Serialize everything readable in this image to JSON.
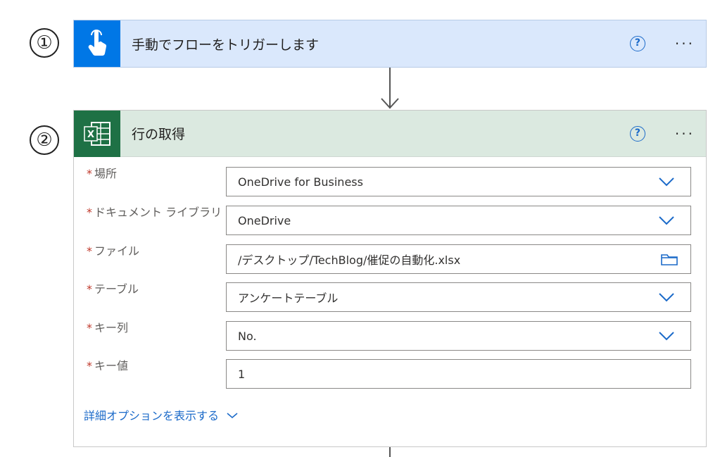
{
  "steps": [
    {
      "number": "①",
      "title": "手動でフローをトリガーします",
      "icon": "touch-hand-icon",
      "color": "#0077e6"
    },
    {
      "number": "②",
      "title": "行の取得",
      "icon": "excel-icon",
      "color": "#1e7145"
    }
  ],
  "fields": [
    {
      "label": "場所",
      "required": "*",
      "value": "OneDrive for Business",
      "control": "dropdown"
    },
    {
      "label": "ドキュメント ライブラリ",
      "required": "*",
      "value": "OneDrive",
      "control": "dropdown"
    },
    {
      "label": "ファイル",
      "required": "*",
      "value": "/デスクトップ/TechBlog/催促の自動化.xlsx",
      "control": "file-picker"
    },
    {
      "label": "テーブル",
      "required": "*",
      "value": "アンケートテーブル",
      "control": "dropdown"
    },
    {
      "label": "キー列",
      "required": "*",
      "value": "No.",
      "control": "dropdown"
    },
    {
      "label": "キー値",
      "required": "*",
      "value": "1",
      "control": "text"
    }
  ],
  "advanced_options": "詳細オプションを表示する",
  "help_symbol": "?",
  "more_symbol": "···"
}
